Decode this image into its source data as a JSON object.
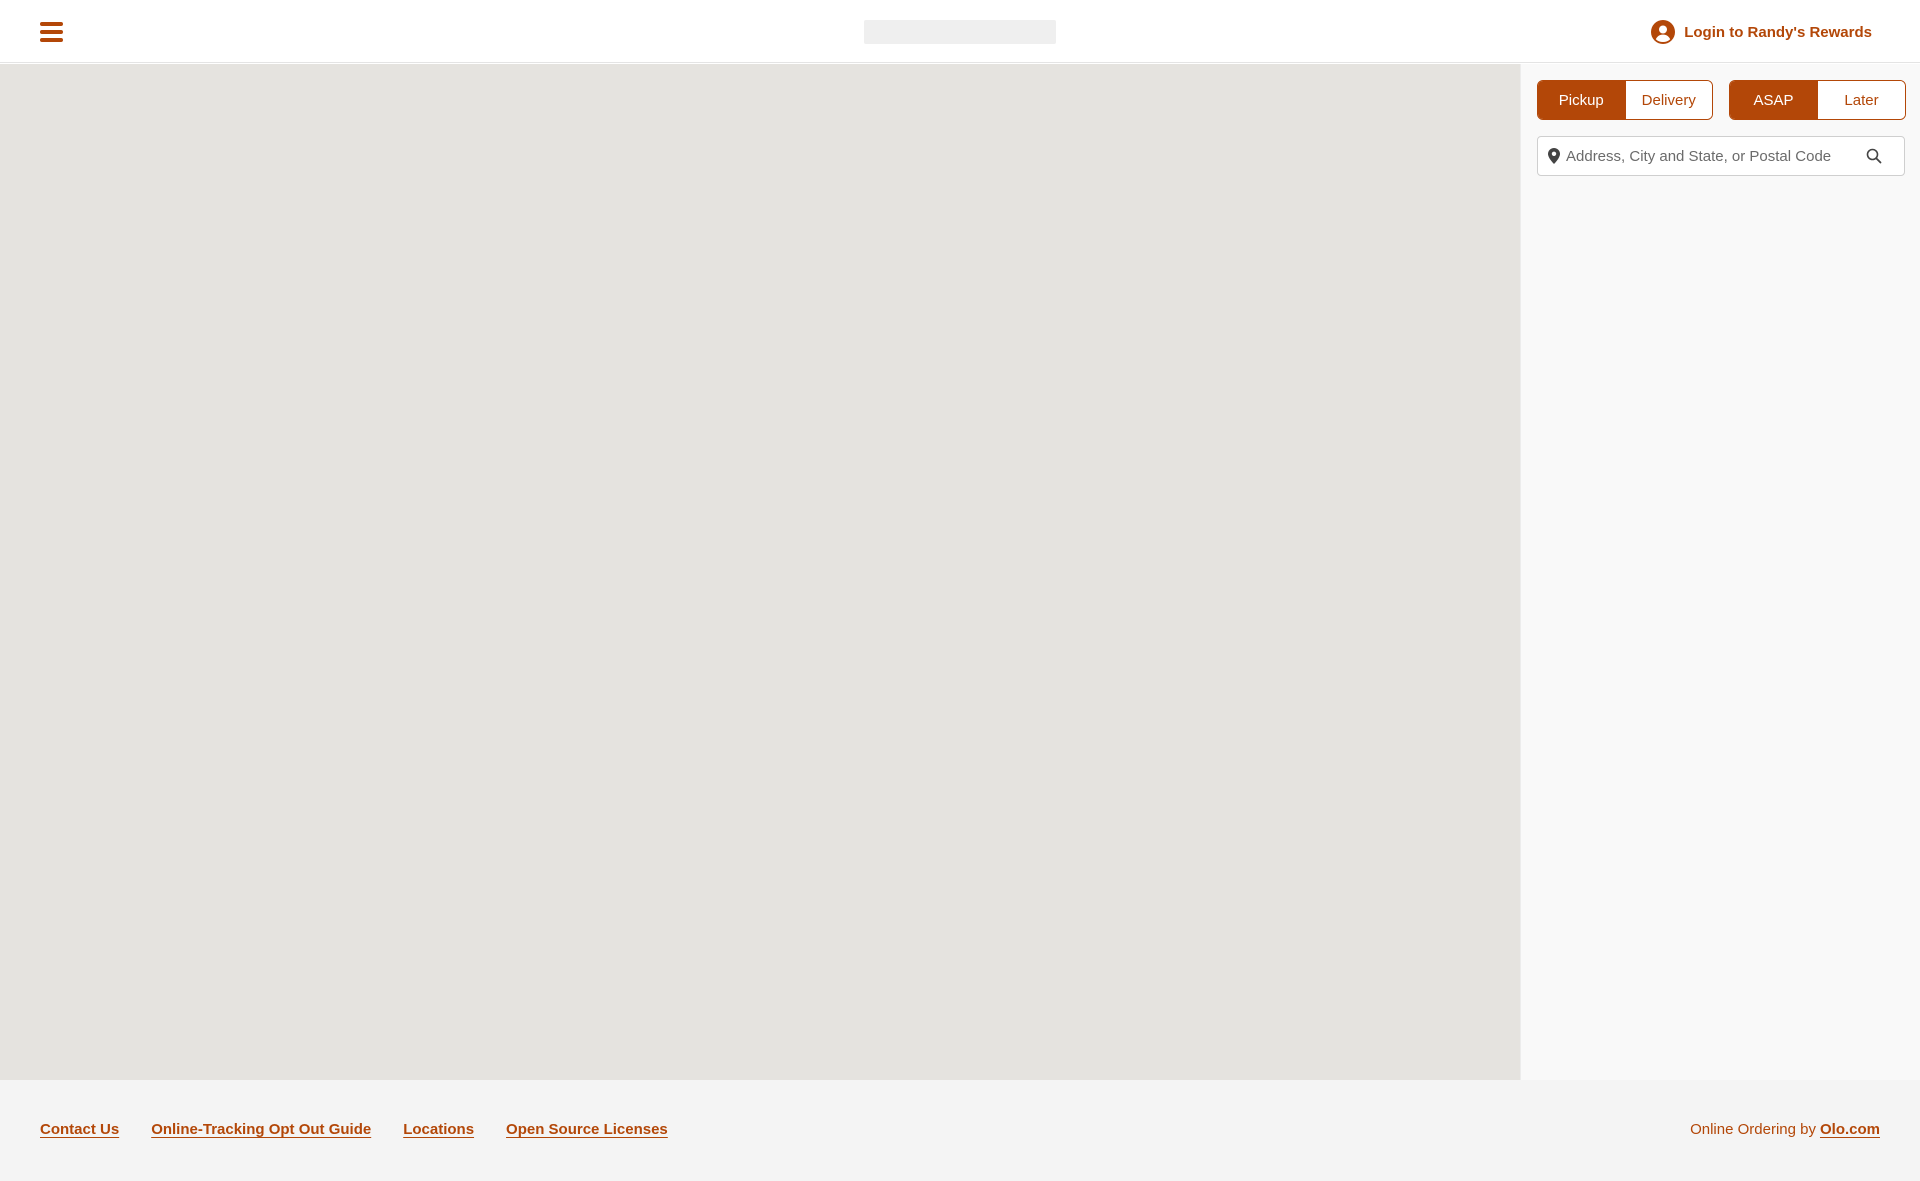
{
  "header": {
    "menu_icon": "hamburger-icon",
    "login_icon": "user-circle-icon",
    "login_label": "Login to Randy's Rewards"
  },
  "side_panel": {
    "handoff_options": [
      {
        "label": "Pickup",
        "selected": true
      },
      {
        "label": "Delivery",
        "selected": false
      }
    ],
    "timing_options": [
      {
        "label": "ASAP",
        "selected": true
      },
      {
        "label": "Later",
        "selected": false
      }
    ],
    "search": {
      "value": "",
      "placeholder": "Address, City and State, or Postal Code",
      "leading_icon": "map-pin-icon",
      "trailing_icon": "search-icon"
    }
  },
  "footer": {
    "links": [
      "Contact Us",
      "Online-Tracking Opt Out Guide",
      "Locations",
      "Open Source Licenses"
    ],
    "powered_by_text": "Online Ordering by",
    "powered_by_link": "Olo.com"
  },
  "colors": {
    "accent": "#b34708",
    "map_background": "#e5e3df",
    "panel_background": "#f9f9f9",
    "footer_background": "#f4f4f4"
  }
}
